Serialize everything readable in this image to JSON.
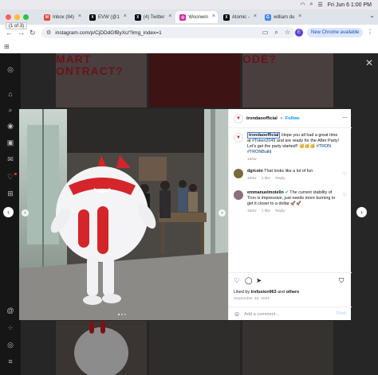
{
  "menubar": {
    "date_time": "Fri Jun 6  1:00 PM"
  },
  "tooltip": "(1 of 3)",
  "tabs": [
    {
      "label": "Inbox (94)",
      "favicon": "gmail-icon",
      "color": "#ea4335",
      "glyph": "M"
    },
    {
      "label": "EVW (@1",
      "favicon": "x-icon",
      "color": "#000000",
      "glyph": "X"
    },
    {
      "label": "(4) Twitter",
      "favicon": "x-icon",
      "color": "#000000",
      "glyph": "X"
    },
    {
      "label": "Woonwin",
      "favicon": "instagram-icon",
      "color": "#d6249f",
      "glyph": "◎"
    },
    {
      "label": "Atomic -",
      "favicon": "x-icon",
      "color": "#000000",
      "glyph": "X"
    },
    {
      "label": "william du",
      "favicon": "google-icon",
      "color": "#4285f4",
      "glyph": "G"
    }
  ],
  "toolbar": {
    "url": "instagram.com/p/CjDDdGfByXc/?img_index=1",
    "profile_initial": "E",
    "update_label": "New Chrome available"
  },
  "background": {
    "text_left": "MART\nONTRACT?",
    "text_right": "ODE?"
  },
  "post": {
    "username": "trondaoofficial",
    "follow_label": "Follow",
    "caption": {
      "author": "trondaoofficial",
      "text_before": "Hope you all had a great time at ",
      "tag1": "#Token2049",
      "text_mid": " and are ready for the After Party! Let's get the party started!!",
      "emojis": "🥳🥳🥳",
      "tag2": "#TRON",
      "tag3": "#TRONBuild",
      "time": "160w"
    },
    "comments": [
      {
        "author": "dgrcoin",
        "text": "That looks like a lot of fun",
        "time": "160w",
        "likes": "1 like",
        "reply": "Reply"
      },
      {
        "author": "emmanuelmotelin",
        "text": "The current stability of Tron is impressive, just needs more burning to get it closer to a dollar 🚀🚀",
        "time": "160w",
        "likes": "1 like",
        "reply": "Reply"
      }
    ],
    "liked_prefix": "Liked by",
    "liked_user": "trxfusion963",
    "liked_and": "and",
    "liked_others": "others",
    "date": "September 28, 2022",
    "add_comment_placeholder": "Add a comment...",
    "post_label": "Post"
  }
}
